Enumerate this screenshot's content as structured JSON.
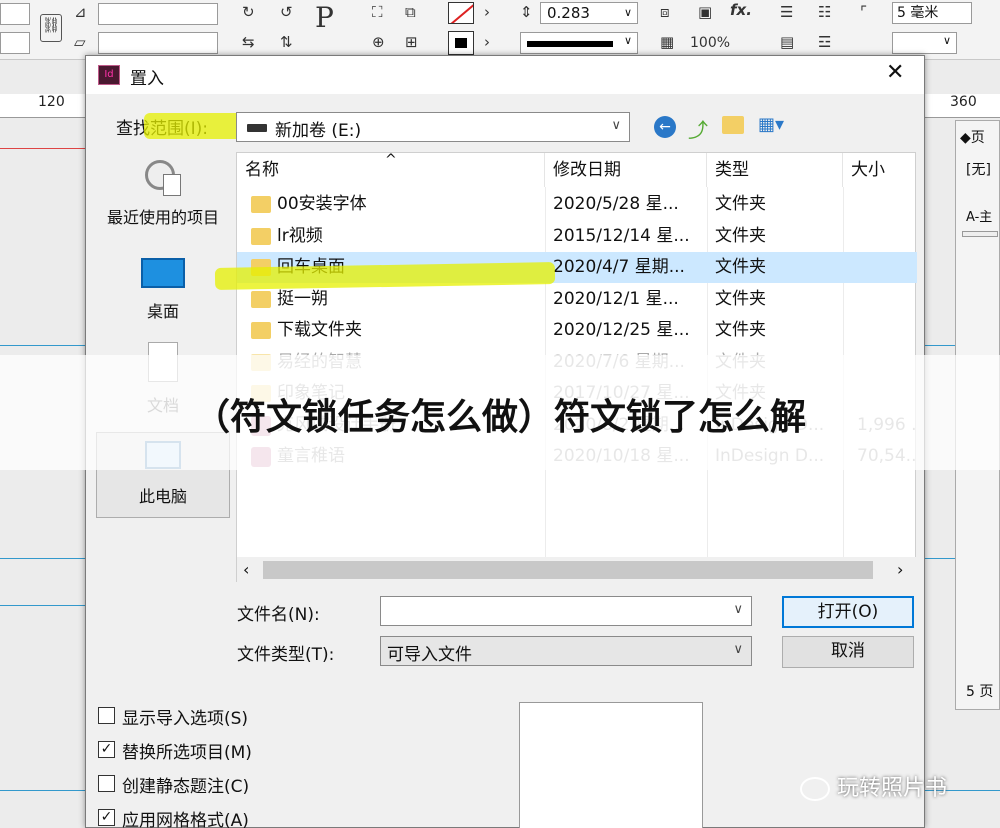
{
  "toolbar": {
    "stroke_weight": "0.283",
    "zoom": "100%",
    "unit_field": "5 毫米",
    "p_label": "P",
    "fx_label": "fx."
  },
  "rulers": {
    "left_mark": "120",
    "right_mark": "360"
  },
  "right_panel": {
    "line1": "页",
    "line2": "[无]",
    "line3": "A-主",
    "line4": "5 页"
  },
  "dialog": {
    "title": "置入",
    "lookin_label": "查找范围(I):",
    "lookin_value": "新加卷 (E:)",
    "filename_label": "文件名(N):",
    "filename_value": "",
    "filetype_label": "文件类型(T):",
    "filetype_value": "可导入文件",
    "open_button": "打开(O)",
    "cancel_button": "取消"
  },
  "places": [
    {
      "label": "最近使用的项目",
      "icon": "recent-items-icon"
    },
    {
      "label": "桌面",
      "icon": "desktop-icon"
    },
    {
      "label": "文档",
      "icon": "documents-icon"
    },
    {
      "label": "此电脑",
      "icon": "this-pc-icon"
    }
  ],
  "columns": [
    "名称",
    "修改日期",
    "类型",
    "大小"
  ],
  "files": [
    {
      "name": "00安装字体",
      "date": "2020/5/28 星...",
      "type": "文件夹",
      "size": "",
      "icon": "folder-icon"
    },
    {
      "name": "lr视频",
      "date": "2015/12/14 星...",
      "type": "文件夹",
      "size": "",
      "icon": "folder-icon"
    },
    {
      "name": "回车桌面",
      "date": "2020/4/7 星期...",
      "type": "文件夹",
      "size": "",
      "icon": "folder-icon"
    },
    {
      "name": "挺一朔",
      "date": "2020/12/1 星...",
      "type": "文件夹",
      "size": "",
      "icon": "folder-icon"
    },
    {
      "name": "下载文件夹",
      "date": "2020/12/25 星...",
      "type": "文件夹",
      "size": "",
      "icon": "folder-icon"
    },
    {
      "name": "易经的智慧",
      "date": "2020/7/6 星期...",
      "type": "文件夹",
      "size": "",
      "icon": "folder-icon"
    },
    {
      "name": "印象笔记",
      "date": "2017/10/27 星...",
      "type": "文件夹",
      "size": "",
      "icon": "folder-icon"
    },
    {
      "name": "克风城设计手册",
      "date": "2020/8/2 星期...",
      "type": "InDesign D...",
      "size": "1,996 ...",
      "icon": "indesign-file-icon"
    },
    {
      "name": "童言稚语",
      "date": "2020/10/18 星...",
      "type": "InDesign D...",
      "size": "70,54...",
      "icon": "indesign-file-icon"
    }
  ],
  "options": [
    {
      "label": "显示导入选项(S)",
      "checked": false
    },
    {
      "label": "替换所选项目(M)",
      "checked": true
    },
    {
      "label": "创建静态题注(C)",
      "checked": false
    },
    {
      "label": "应用网格格式(A)",
      "checked": true
    }
  ],
  "banner": "（符文锁任务怎么做）符文锁了怎么解",
  "watermark": "玩转照片书",
  "colors": {
    "selected_row": "#cce8ff",
    "highlighter": "#e6f000",
    "folder": "#f3cf65"
  }
}
